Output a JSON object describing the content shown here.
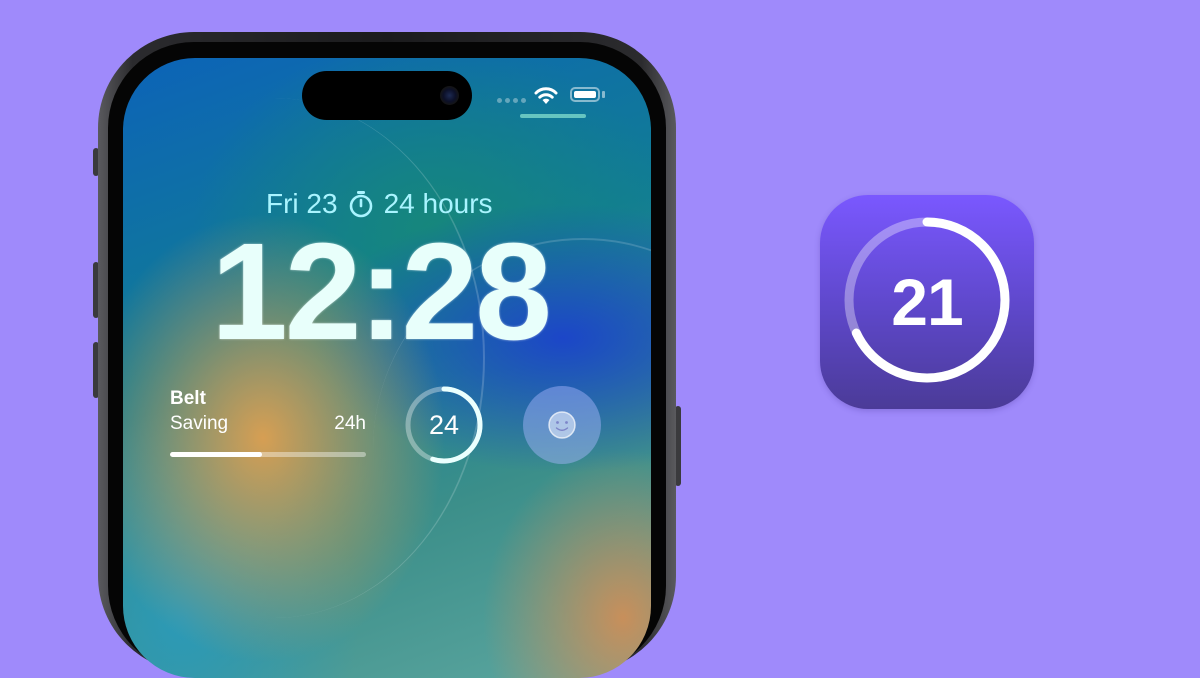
{
  "lockscreen": {
    "date": "Fri 23",
    "timer_label": "24 hours",
    "time": "12:28"
  },
  "widgets": {
    "belt": {
      "title": "Belt",
      "subtitle": "Saving",
      "duration": "24h",
      "progress": 0.47
    },
    "ring": {
      "value": "24",
      "progress": 0.55
    },
    "face": {
      "icon": "smiley-icon"
    }
  },
  "app_icon": {
    "number": "21",
    "progress": 0.68
  },
  "colors": {
    "background": "#9f8afb",
    "icon_gradient_top": "#7a58ff",
    "icon_gradient_bottom": "#4b3b98",
    "date_text": "#a9f4ff"
  }
}
